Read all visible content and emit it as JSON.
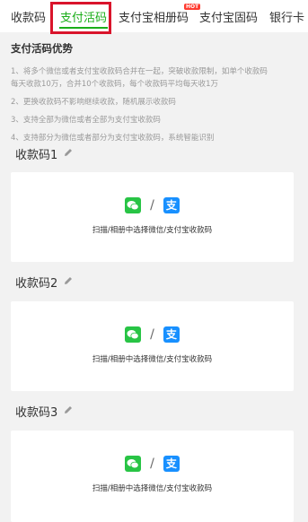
{
  "tabs": [
    {
      "label": "收款码"
    },
    {
      "label": "支付活码"
    },
    {
      "label": "支付宝相册码"
    },
    {
      "label": "支付宝固码"
    },
    {
      "label": "银行卡"
    }
  ],
  "hot_badge": "HOT",
  "advantages": {
    "title": "支付活码优势",
    "items": [
      "1、将多个微信或者支付宝收款码合并在一起，突破收款限制，如单个收款码",
      "每天收款10万，合并10个收款码，每个收款码平均每天收1万",
      "2、更换收款码不影响继续收款，随机展示收款码",
      "3、支持全部为微信或者全部为支付宝收款码",
      "4、支持部分为微信或者部分为支付宝收款码，系统智能识别"
    ]
  },
  "sections": [
    {
      "title": "收款码1",
      "hint": "扫描/相册中选择微信/支付宝收款码",
      "slash": "/"
    },
    {
      "title": "收款码2",
      "hint": "扫描/相册中选择微信/支付宝收款码",
      "slash": "/"
    },
    {
      "title": "收款码3",
      "hint": "扫描/相册中选择微信/支付宝收款码",
      "slash": "/"
    }
  ],
  "icons": {
    "wechat": "wechat-pay-icon",
    "alipay": "alipay-icon",
    "edit": "pencil-icon",
    "alipay_glyph": "支"
  },
  "colors": {
    "active_tab": "#1aad19",
    "highlight": "#d9142b",
    "wechat": "#28c445",
    "alipay": "#1890ff"
  }
}
